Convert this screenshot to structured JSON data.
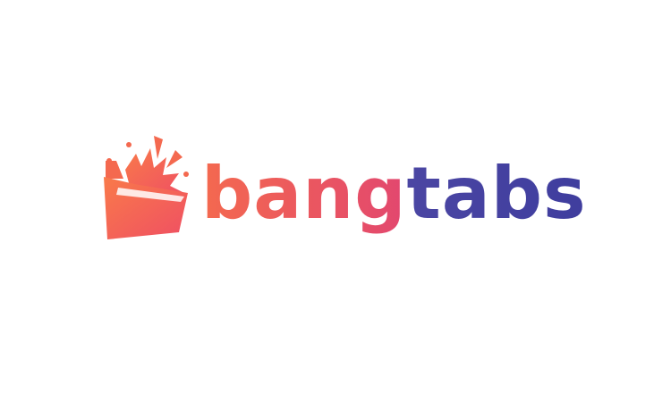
{
  "brand": {
    "name_part_1": "bang",
    "name_part_2": "tabs",
    "colors": {
      "background": "#ffffff",
      "coral": "#f4694f",
      "pink": "#e2476f",
      "indigo": "#4b46a3",
      "deep_indigo": "#3f3d9e"
    },
    "icon": "bursting-folder-icon"
  }
}
